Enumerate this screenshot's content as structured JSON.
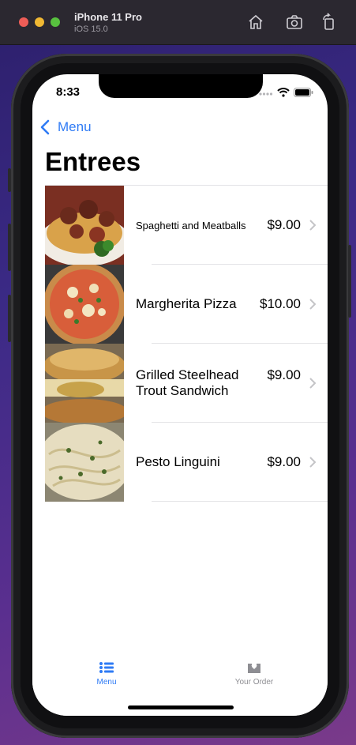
{
  "simulator": {
    "device_name": "iPhone 11 Pro",
    "os_version": "iOS 15.0"
  },
  "status_bar": {
    "time": "8:33"
  },
  "nav": {
    "back_label": "Menu",
    "title": "Entrees"
  },
  "items": [
    {
      "name": "Spaghetti and Meatballs",
      "price": "$9.00",
      "image": "spaghetti-meatballs"
    },
    {
      "name": "Margherita Pizza",
      "price": "$10.00",
      "image": "margherita-pizza"
    },
    {
      "name": "Grilled Steelhead Trout Sandwich",
      "price": "$9.00",
      "image": "trout-sandwich"
    },
    {
      "name": "Pesto Linguini",
      "price": "$9.00",
      "image": "pesto-linguini"
    }
  ],
  "tabs": [
    {
      "label": "Menu",
      "icon": "list-icon",
      "selected": true
    },
    {
      "label": "Your Order",
      "icon": "tray-icon",
      "selected": false
    }
  ],
  "colors": {
    "accent": "#2f7bf5",
    "inactive": "#8e8e93"
  }
}
